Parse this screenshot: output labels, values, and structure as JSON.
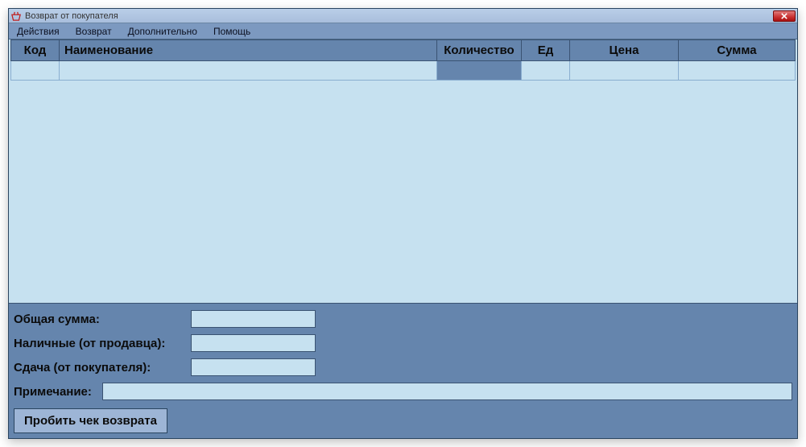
{
  "window": {
    "title": "Возврат от покупателя"
  },
  "menu": {
    "items": [
      "Действия",
      "Возврат",
      "Дополнительно",
      "Помощь"
    ]
  },
  "table": {
    "headers": {
      "code": "Код",
      "name": "Наименование",
      "qty": "Количество",
      "unit": "Ед",
      "price": "Цена",
      "sum": "Сумма"
    },
    "rows": [
      {
        "code": "",
        "name": "",
        "qty": "",
        "unit": "",
        "price": "",
        "sum": ""
      }
    ],
    "selected_col": "qty"
  },
  "totals": {
    "total_label": "Общая сумма:",
    "total_value": "",
    "cash_label": "Наличные (от продавца):",
    "cash_value": "",
    "change_label": "Сдача (от покупателя):",
    "change_value": "",
    "note_label": "Примечание:",
    "note_value": ""
  },
  "actions": {
    "submit_label": "Пробить чек возврата"
  }
}
